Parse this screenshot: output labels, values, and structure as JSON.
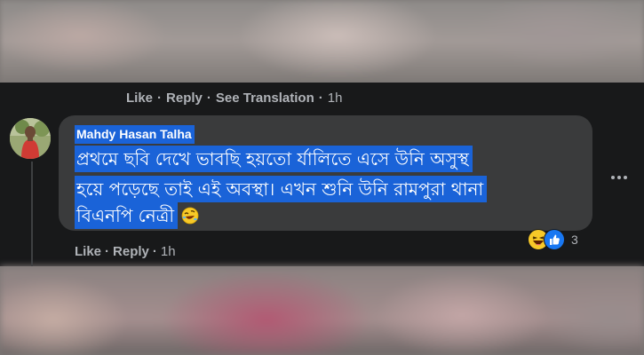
{
  "parent_comment_actions": {
    "like": "Like",
    "reply": "Reply",
    "see_translation": "See Translation",
    "time": "1h",
    "separator": "·"
  },
  "comment": {
    "author": "Mahdy Hasan Talha",
    "lines": [
      "প্রথমে ছবি দেখে ভাবছি হয়তো র্যালিতে এসে উনি অসুস্থ",
      "হয়ে পড়েছে তাই এই অবস্থা। এখন শুনি উনি রামপুরা থানা",
      "বিএনপি নেত্রী"
    ],
    "inline_emoji": "rolling-on-floor-laughing-emoji",
    "reactions": {
      "icons": [
        "haha-reaction-icon",
        "like-reaction-icon"
      ],
      "count": "3"
    },
    "actions": {
      "like": "Like",
      "reply": "Reply",
      "time": "1h",
      "separator": "·"
    }
  },
  "colors": {
    "panel": "#18191a",
    "bubble": "#3a3b3c",
    "selection": "#1a63d8",
    "muted_text": "#b0b3b8",
    "like_blue": "#1877f2",
    "haha_yellow": "#f7c928"
  }
}
